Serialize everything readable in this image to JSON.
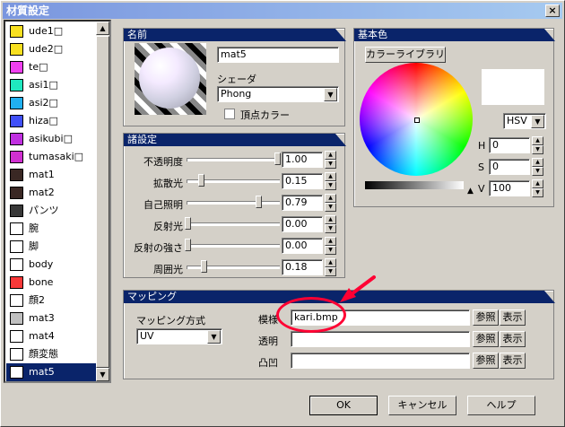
{
  "window": {
    "title": "材質設定",
    "close_label": "×"
  },
  "materials": [
    {
      "name": "ude1□",
      "color": "#f8e020"
    },
    {
      "name": "ude2□",
      "color": "#f8e020"
    },
    {
      "name": "te□",
      "color": "#f040f0"
    },
    {
      "name": "asi1□",
      "color": "#20e8c0"
    },
    {
      "name": "asi2□",
      "color": "#20b0f0"
    },
    {
      "name": "hiza□",
      "color": "#4050f8"
    },
    {
      "name": "asikubi□",
      "color": "#c030e0"
    },
    {
      "name": "tumasaki□",
      "color": "#d030d0"
    },
    {
      "name": "mat1",
      "color": "#3a2824"
    },
    {
      "name": "mat2",
      "color": "#3a2824"
    },
    {
      "name": "パンツ",
      "color": "#383838"
    },
    {
      "name": "腕",
      "color": "#ffffff"
    },
    {
      "name": "脚",
      "color": "#ffffff"
    },
    {
      "name": "body",
      "color": "#ffffff"
    },
    {
      "name": "bone",
      "color": "#f83838"
    },
    {
      "name": "顔2",
      "color": "#ffffff"
    },
    {
      "name": "mat3",
      "color": "#c0c0c0"
    },
    {
      "name": "mat4",
      "color": "#ffffff"
    },
    {
      "name": "顔変態",
      "color": "#ffffff"
    },
    {
      "name": "mat5",
      "color": "#ffffff",
      "selected": true
    }
  ],
  "name_group": {
    "header": "名前",
    "name_value": "mat5",
    "shader_label": "シェーダ",
    "shader_value": "Phong",
    "vertex_color_label": "頂点カラー"
  },
  "settings_group": {
    "header": "諸設定",
    "rows": [
      {
        "label": "不透明度",
        "value": "1.00",
        "level": 1.0
      },
      {
        "label": "拡散光",
        "value": "0.15",
        "level": 0.15
      },
      {
        "label": "自己照明",
        "value": "0.79",
        "level": 0.79
      },
      {
        "label": "反射光",
        "value": "0.00",
        "level": 0.0
      },
      {
        "label": "反射の強さ",
        "value": "0.00",
        "level": 0.0
      },
      {
        "label": "周囲光",
        "value": "0.18",
        "level": 0.18
      }
    ]
  },
  "color_group": {
    "header": "基本色",
    "library_button": "カラーライブラリ",
    "mode_value": "HSV",
    "h_label": "H",
    "h_value": "0",
    "s_label": "S",
    "s_value": "0",
    "v_label": "V",
    "v_value": "100",
    "color": "#ffffff"
  },
  "mapping_group": {
    "header": "マッピング",
    "method_label": "マッピング方式",
    "method_value": "UV",
    "rows": [
      {
        "label": "模様",
        "value": "kari.bmp",
        "browse": "参照",
        "show": "表示"
      },
      {
        "label": "透明",
        "value": "",
        "browse": "参照",
        "show": "表示"
      },
      {
        "label": "凸凹",
        "value": "",
        "browse": "参照",
        "show": "表示"
      }
    ]
  },
  "footer": {
    "ok": "OK",
    "cancel": "キャンセル",
    "help": "ヘルプ"
  },
  "annotation": {
    "color": "#ff0033"
  }
}
